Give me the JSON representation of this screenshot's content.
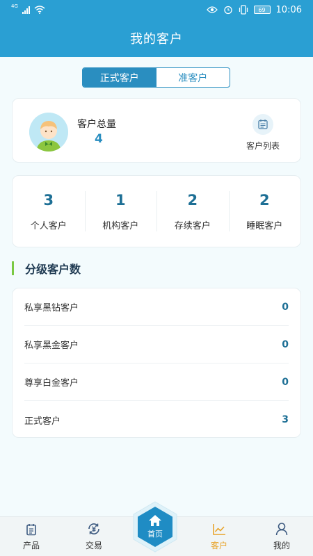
{
  "status_bar": {
    "network": "4G",
    "battery": "69",
    "time": "10:06"
  },
  "header": {
    "title": "我的客户"
  },
  "segment": {
    "tabs": [
      {
        "label": "正式客户",
        "active": true
      },
      {
        "label": "准客户",
        "active": false
      }
    ]
  },
  "total_card": {
    "label": "客户总量",
    "value": "4",
    "list_button_label": "客户列表"
  },
  "stats": [
    {
      "value": "3",
      "label": "个人客户"
    },
    {
      "value": "1",
      "label": "机构客户"
    },
    {
      "value": "2",
      "label": "存续客户"
    },
    {
      "value": "2",
      "label": "睡眠客户"
    }
  ],
  "levels": {
    "title": "分级客户数",
    "items": [
      {
        "name": "私享黑钻客户",
        "count": "0"
      },
      {
        "name": "私享黑金客户",
        "count": "0"
      },
      {
        "name": "尊享白金客户",
        "count": "0"
      },
      {
        "name": "正式客户",
        "count": "3"
      }
    ]
  },
  "tabbar": {
    "items": [
      {
        "label": "产品",
        "icon": "product-icon"
      },
      {
        "label": "交易",
        "icon": "trade-icon"
      },
      {
        "label": "首页",
        "icon": "home-icon"
      },
      {
        "label": "客户",
        "icon": "chart-icon",
        "active": true
      },
      {
        "label": "我的",
        "icon": "user-icon"
      }
    ]
  },
  "colors": {
    "primary": "#2a9fd3",
    "accent": "#e8a42b",
    "value": "#1d6f95",
    "section_bar": "#7ac943"
  }
}
